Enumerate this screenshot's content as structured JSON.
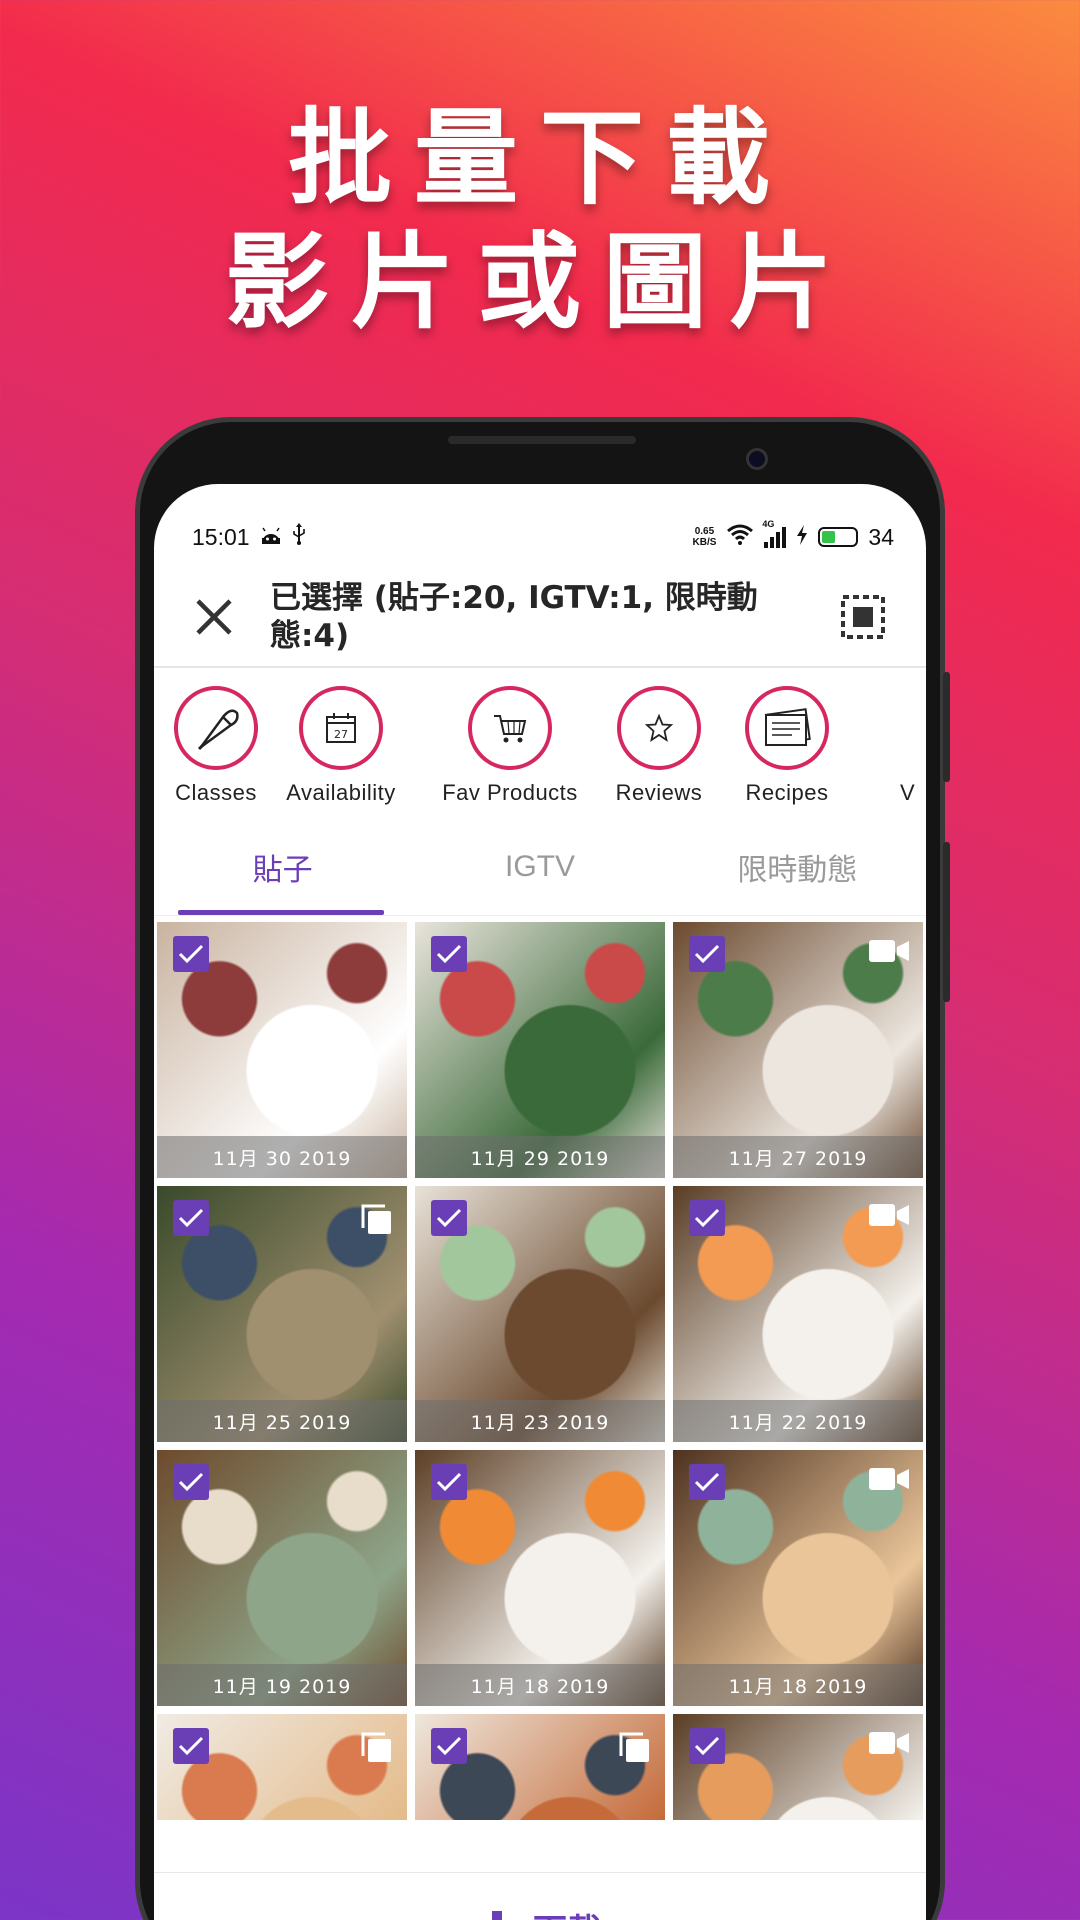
{
  "promo": {
    "headline_line1": "批量下載",
    "headline_line2": "影片或圖片"
  },
  "status_bar": {
    "time": "15:01",
    "net_speed_value": "0.65",
    "net_speed_unit": "KB/S",
    "network": "4G",
    "battery": "34"
  },
  "app_bar": {
    "title": "已選擇 (貼子:20, IGTV:1, 限時動態:4)",
    "close_icon": "close-icon",
    "select_all_icon": "select-all-icon"
  },
  "highlights": [
    {
      "label": "Classes",
      "icon": "piping-bag-icon"
    },
    {
      "label": "Availability",
      "icon": "calendar-icon",
      "icon_text": "27"
    },
    {
      "label": "Fav Products",
      "icon": "cart-icon"
    },
    {
      "label": "Reviews",
      "icon": "star-icon"
    },
    {
      "label": "Recipes",
      "icon": "recipe-card-icon"
    },
    {
      "label": "V",
      "icon": "partial-icon"
    }
  ],
  "tabs": [
    {
      "label": "貼子",
      "active": true
    },
    {
      "label": "IGTV",
      "active": false
    },
    {
      "label": "限時動態",
      "active": false
    }
  ],
  "posts": [
    {
      "date": "11月 30 2019",
      "type": "image",
      "bg": [
        "#c9b3a0",
        "#ffffff",
        "#8d3b3b"
      ]
    },
    {
      "date": "11月 29 2019",
      "type": "image",
      "bg": [
        "#e9e4dc",
        "#3b6a3a",
        "#c94a48"
      ]
    },
    {
      "date": "11月 27 2019",
      "type": "video",
      "bg": [
        "#6b4a2f",
        "#ece6df",
        "#4b7c4a"
      ]
    },
    {
      "date": "11月 25 2019",
      "type": "carousel",
      "bg": [
        "#394a2a",
        "#a09070",
        "#3d4f67"
      ]
    },
    {
      "date": "11月 23 2019",
      "type": "image",
      "bg": [
        "#e8e2d8",
        "#6b4a2f",
        "#a3c79c"
      ]
    },
    {
      "date": "11月 22 2019",
      "type": "video",
      "bg": [
        "#5a3d24",
        "#f4f1ec",
        "#f39b52"
      ]
    },
    {
      "date": "11月 19 2019",
      "type": "image",
      "bg": [
        "#6e4a2c",
        "#8ea589",
        "#e8dccb"
      ]
    },
    {
      "date": "11月 18 2019",
      "type": "image",
      "bg": [
        "#5c3f26",
        "#f4f1ec",
        "#f08a34"
      ]
    },
    {
      "date": "11月 18 2019",
      "type": "video",
      "bg": [
        "#4d3220",
        "#eac59a",
        "#8fb39a"
      ]
    },
    {
      "date": "",
      "type": "carousel",
      "bg": [
        "#f0ebe4",
        "#e4bb8a",
        "#d97b4f"
      ]
    },
    {
      "date": "",
      "type": "carousel",
      "bg": [
        "#eee7dd",
        "#c56b3a",
        "#3c4856"
      ]
    },
    {
      "date": "",
      "type": "video",
      "bg": [
        "#5a3d24",
        "#f4f1ec",
        "#e59c5c"
      ]
    }
  ],
  "bottom_bar": {
    "download_label": "下載",
    "download_icon": "download-icon"
  },
  "colors": {
    "accent": "#6a3fb5",
    "highlight_ring": "#d6285f"
  }
}
